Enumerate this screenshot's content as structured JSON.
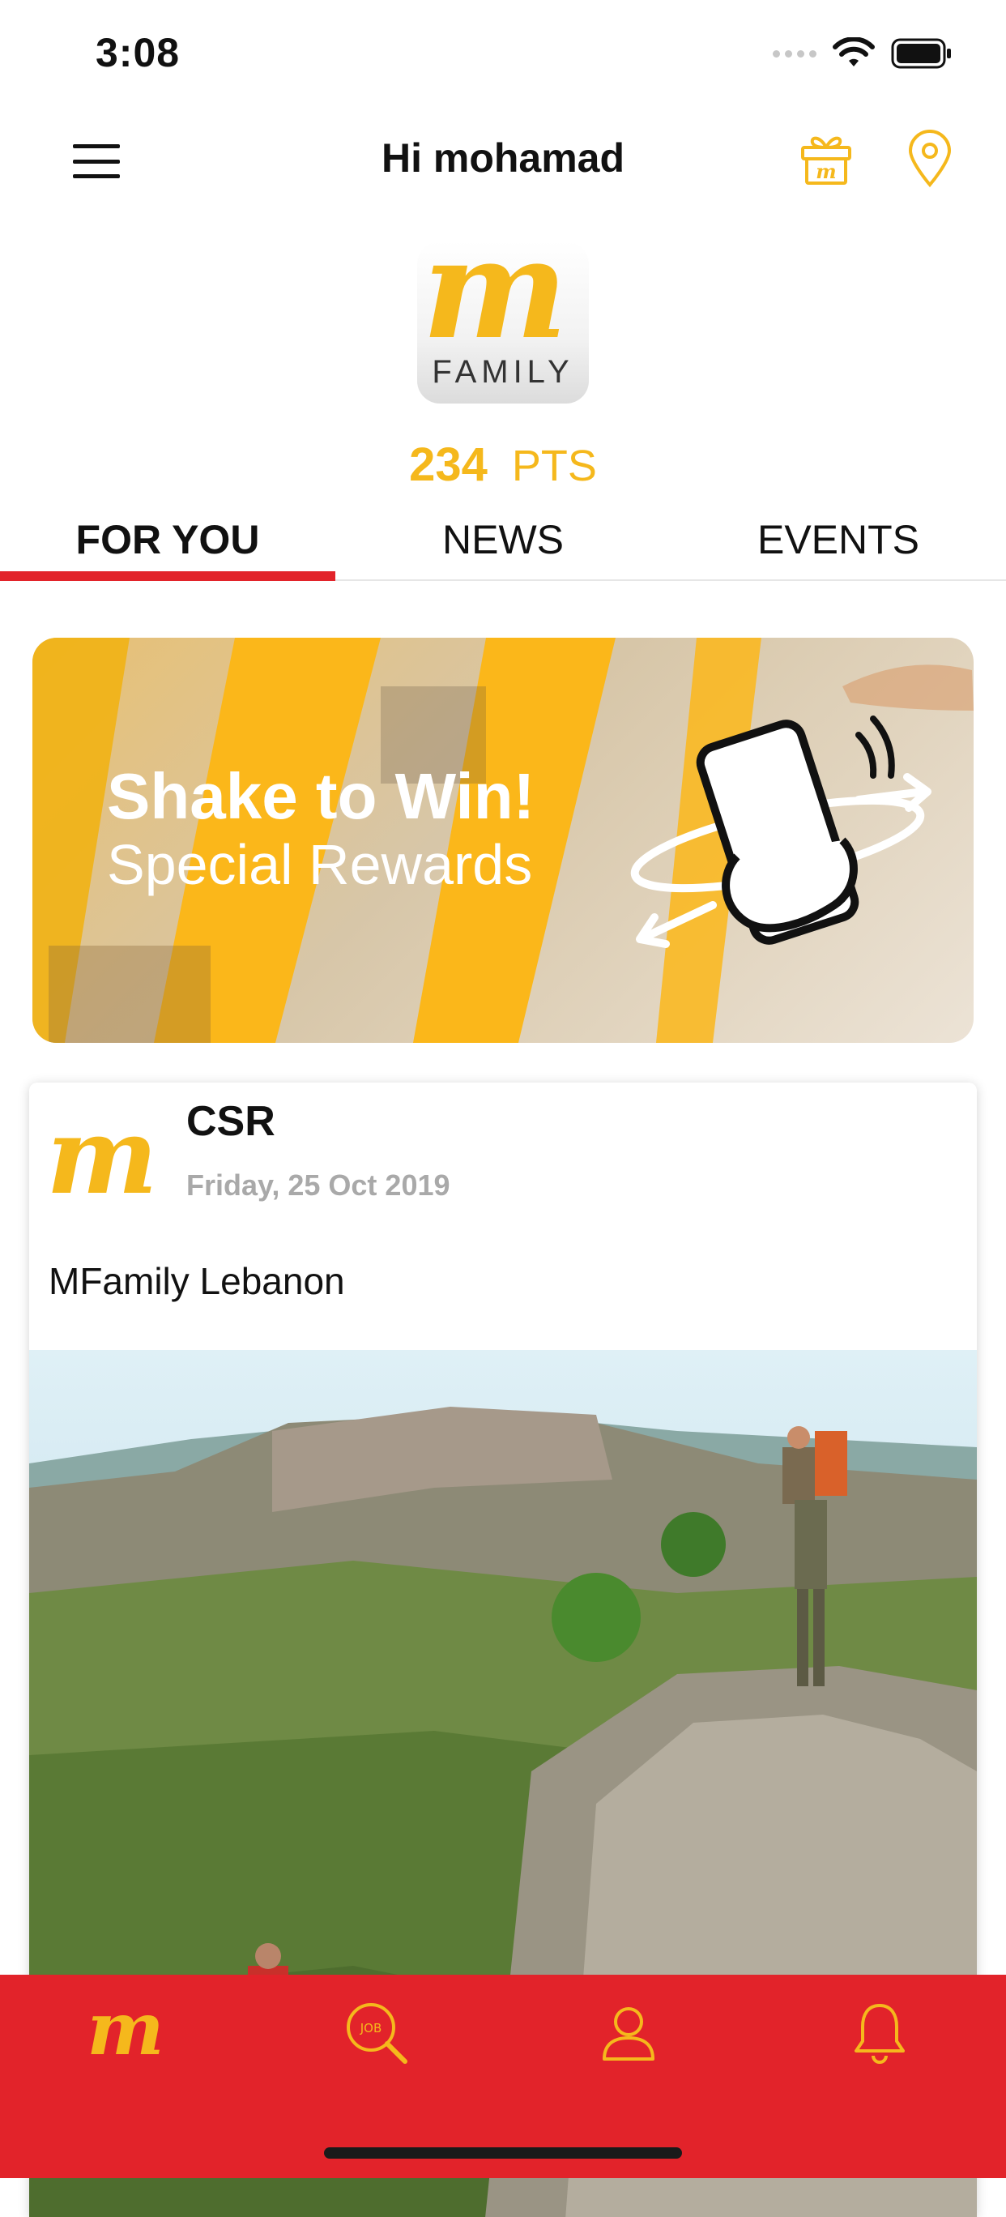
{
  "status_bar": {
    "time": "3:08"
  },
  "header": {
    "greeting": "Hi mohamad"
  },
  "logo": {
    "brand_letter": "m",
    "brand_word": "FAMILY"
  },
  "points": {
    "value": "234",
    "unit": "PTS"
  },
  "tabs": [
    {
      "label": "FOR YOU",
      "active": true
    },
    {
      "label": "NEWS",
      "active": false
    },
    {
      "label": "EVENTS",
      "active": false
    }
  ],
  "banner": {
    "title": "Shake to Win!",
    "subtitle": "Special Rewards"
  },
  "post": {
    "category": "CSR",
    "date": "Friday, 25 Oct 2019",
    "text": "MFamily Lebanon"
  },
  "bottom_nav": {
    "job_icon_text": "JOB",
    "items": [
      "home-m-icon",
      "job-search-icon",
      "profile-icon",
      "bell-icon"
    ]
  },
  "colors": {
    "accent_yellow": "#f5b81c",
    "brand_red": "#e2232a",
    "muted_gray": "#a9a9a9"
  }
}
